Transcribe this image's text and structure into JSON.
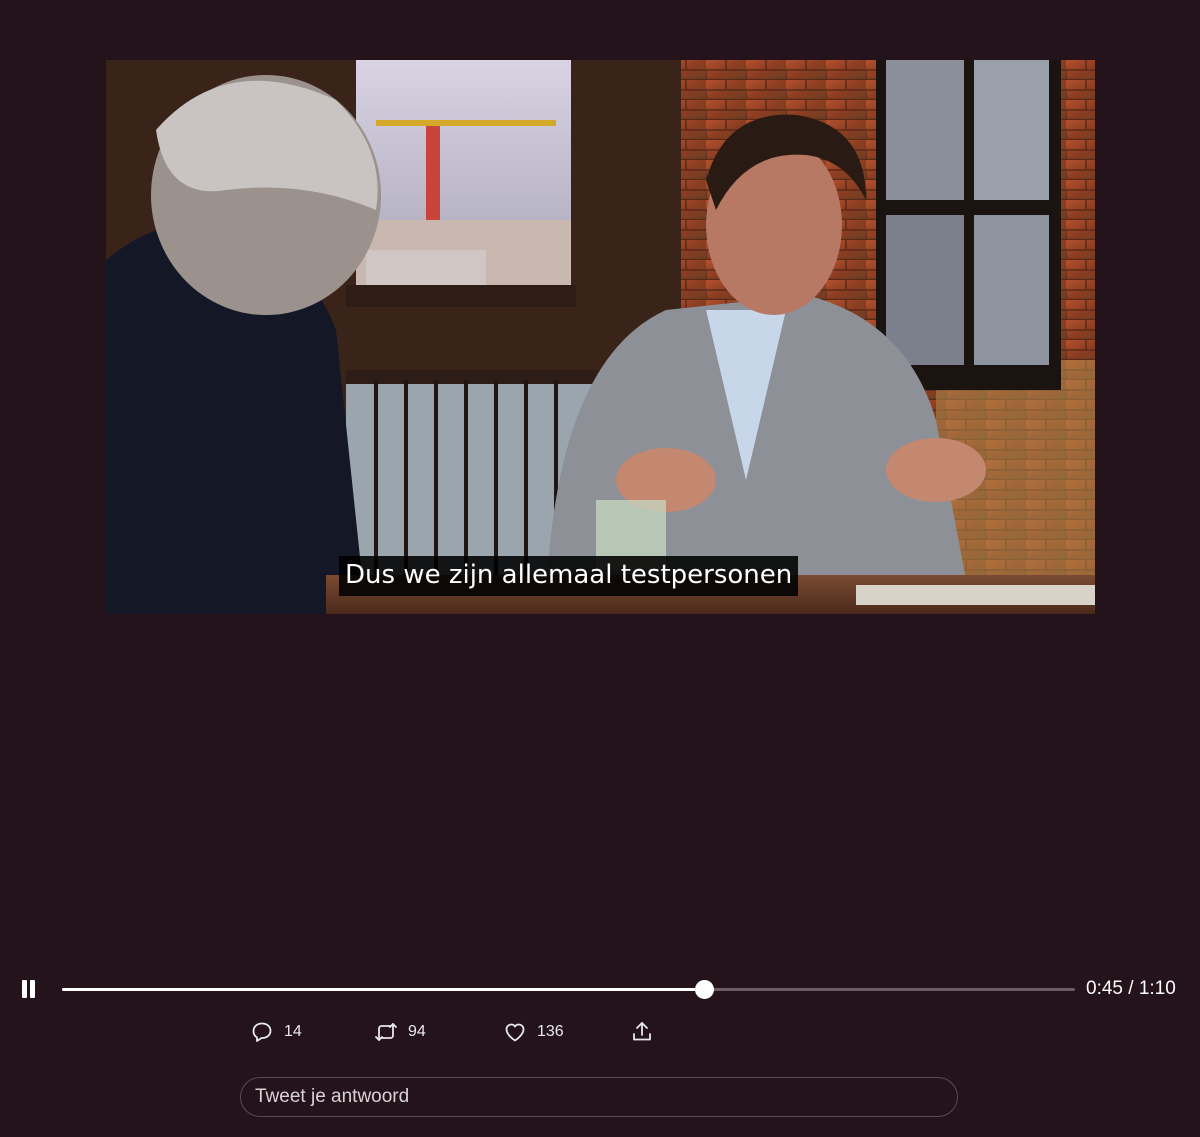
{
  "video": {
    "subtitle": "Dus we zijn allemaal testpersonen"
  },
  "player": {
    "state_icon": "pause-icon",
    "progress_fraction": 0.634,
    "current_time": "0:45",
    "separator": "/",
    "duration": "1:10"
  },
  "actions": {
    "reply": {
      "icon": "reply-icon",
      "count": "14"
    },
    "retweet": {
      "icon": "retweet-icon",
      "count": "94"
    },
    "like": {
      "icon": "heart-icon",
      "count": "136"
    },
    "share": {
      "icon": "share-icon"
    }
  },
  "reply_box": {
    "placeholder": "Tweet je antwoord"
  },
  "colors": {
    "background": "#24131b",
    "text": "#e7e9ea",
    "progress_fill": "#ffffff",
    "progress_track": "#6e5a64"
  }
}
